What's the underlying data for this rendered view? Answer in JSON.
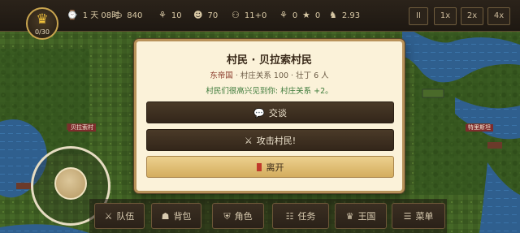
{
  "hud": {
    "crown_icon": "crown-icon",
    "villager_count": "0/30",
    "stats": [
      {
        "icon": "clock-icon",
        "glyph": "⌚",
        "text": "1 天 08时"
      },
      {
        "icon": "money-bag-icon",
        "glyph": "⛀",
        "text": "840"
      },
      {
        "icon": "wheat-icon",
        "glyph": "⚘",
        "text": "10"
      },
      {
        "icon": "smiley-icon",
        "glyph": "☻",
        "text": "70"
      },
      {
        "icon": "people-icon",
        "glyph": "⚇",
        "text": "11+0"
      },
      {
        "icon": "medal-icon",
        "glyph": "⚘",
        "text": "0"
      },
      {
        "icon": "star-icon",
        "glyph": "★",
        "text": "0"
      },
      {
        "icon": "horse-icon",
        "glyph": "♞",
        "text": "2.93"
      }
    ],
    "speed_buttons": [
      "II",
      "1x",
      "2x",
      "4x"
    ]
  },
  "dialog": {
    "title": "村民 · 贝拉索村民",
    "faction": "东帝国",
    "relation": "· 村庄关系 100 · 壮丁 6 人",
    "message": "村民们很高兴见到你: 村庄关系 +2。",
    "buttons": [
      {
        "label": "交谈",
        "icon": "speech-bubble-icon",
        "glyph": "💬"
      },
      {
        "label": "攻击村民!",
        "icon": "crossed-swords-icon",
        "glyph": "⚔"
      },
      {
        "label": "离开",
        "icon": "exit-door-icon"
      }
    ]
  },
  "bottom_menu": [
    {
      "label": "队伍",
      "icon": "swords-icon",
      "glyph": "⚔"
    },
    {
      "label": "背包",
      "icon": "backpack-icon",
      "glyph": "☗"
    },
    {
      "label": "角色",
      "icon": "shield-icon",
      "glyph": "⛨"
    },
    {
      "label": "任务",
      "icon": "scroll-icon",
      "glyph": "☷"
    },
    {
      "label": "王国",
      "icon": "crown-icon",
      "glyph": "♛"
    },
    {
      "label": "菜单",
      "icon": "menu-icon",
      "glyph": "☰"
    }
  ],
  "map_labels": [
    "贝拉索村",
    "特里斯坦"
  ],
  "colors": {
    "accent_gold": "#c9a54f",
    "dialog_bg": "#fbf2d9",
    "positive_text": "#3c7a3a",
    "faction_text": "#8a3a2a"
  }
}
